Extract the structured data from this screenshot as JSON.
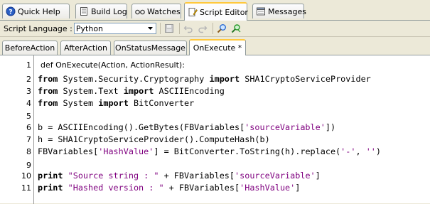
{
  "top_tabs": [
    {
      "label": "Quick Help",
      "icon": "help-icon"
    },
    {
      "label": "Build Log",
      "icon": "document-icon"
    },
    {
      "label": "Watches",
      "icon": "glasses-icon"
    },
    {
      "label": "Script Editor",
      "icon": "script-editor-icon"
    },
    {
      "label": "Messages",
      "icon": "messages-icon"
    }
  ],
  "active_top_tab": "Script Editor",
  "toolbar": {
    "language_label": "Script Language :",
    "language_value": "Python",
    "buttons": [
      "save-icon",
      "undo-icon",
      "redo-icon",
      "find-icon",
      "replace-icon"
    ]
  },
  "sub_tabs": [
    {
      "label": "BeforeAction"
    },
    {
      "label": "AfterAction"
    },
    {
      "label": "OnStatusMessage"
    },
    {
      "label": "OnExecute *"
    }
  ],
  "active_sub_tab": "OnExecute *",
  "editor": {
    "signature": "def OnExecute(Action, ActionResult):",
    "lines": [
      {
        "n": "1",
        "text": "def OnExecute(Action, ActionResult):"
      },
      {
        "n": "2",
        "text": "from System.Security.Cryptography import SHA1CryptoServiceProvider"
      },
      {
        "n": "3",
        "text": "from System.Text import ASCIIEncoding"
      },
      {
        "n": "4",
        "text": "from System import BitConverter"
      },
      {
        "n": "5",
        "text": ""
      },
      {
        "n": "6",
        "text": "b = ASCIIEncoding().GetBytes(FBVariables['sourceVariable'])"
      },
      {
        "n": "7",
        "text": "h = SHA1CryptoServiceProvider().ComputeHash(b)"
      },
      {
        "n": "8",
        "text": "FBVariables['HashValue'] = BitConverter.ToString(h).replace('-', '')"
      },
      {
        "n": "9",
        "text": ""
      },
      {
        "n": "10",
        "text": "print \"Source string : \" + FBVariables['sourceVariable']"
      },
      {
        "n": "11",
        "text": "print \"Hashed version : \" + FBVariables['HashValue']"
      }
    ]
  },
  "colors": {
    "keyword": "#000000",
    "string": "#7f007f",
    "active_tab_accent": "#ffc83c"
  }
}
